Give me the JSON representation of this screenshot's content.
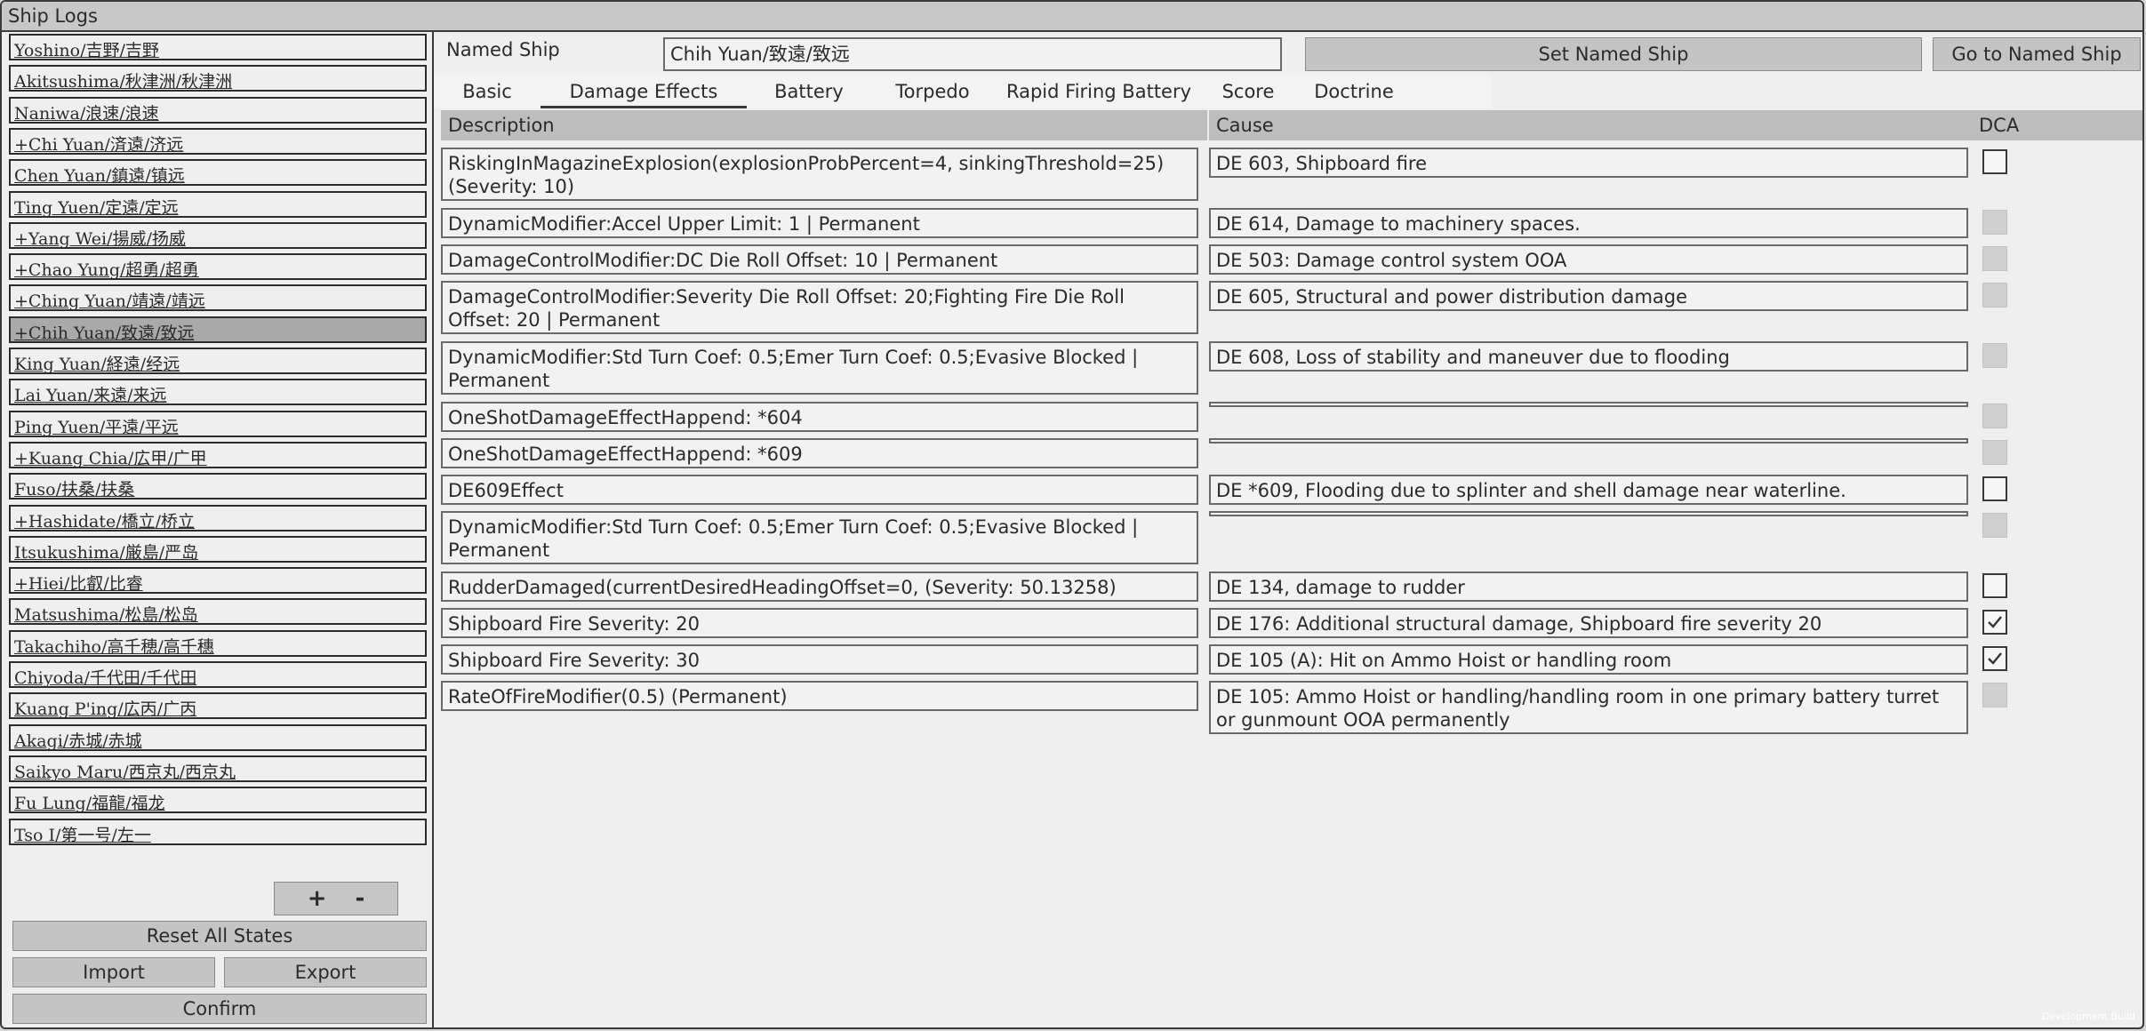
{
  "window": {
    "title": "Ship Logs"
  },
  "ships": [
    {
      "label": "Yoshino/吉野/吉野",
      "selected": false
    },
    {
      "label": "Akitsushima/秋津洲/秋津洲",
      "selected": false
    },
    {
      "label": "Naniwa/浪速/浪速",
      "selected": false
    },
    {
      "label": "+Chi Yuan/済遠/济远",
      "selected": false
    },
    {
      "label": "Chen Yuan/鎮遠/镇远",
      "selected": false
    },
    {
      "label": "Ting Yuen/定遠/定远",
      "selected": false
    },
    {
      "label": "+Yang Wei/揚威/扬威",
      "selected": false
    },
    {
      "label": "+Chao Yung/超勇/超勇",
      "selected": false
    },
    {
      "label": "+Ching Yuan/靖遠/靖远",
      "selected": false
    },
    {
      "label": "+Chih Yuan/致遠/致远",
      "selected": true
    },
    {
      "label": "King Yuan/経遠/经远",
      "selected": false
    },
    {
      "label": "Lai Yuan/来遠/来远",
      "selected": false
    },
    {
      "label": "Ping Yuen/平遠/平远",
      "selected": false
    },
    {
      "label": "+Kuang Chia/広甲/广甲",
      "selected": false
    },
    {
      "label": "Fuso/扶桑/扶桑",
      "selected": false
    },
    {
      "label": "+Hashidate/橋立/桥立",
      "selected": false
    },
    {
      "label": "Itsukushima/厳島/严岛",
      "selected": false
    },
    {
      "label": "+Hiei/比叡/比睿",
      "selected": false
    },
    {
      "label": "Matsushima/松島/松岛",
      "selected": false
    },
    {
      "label": "Takachiho/高千穂/高千穗",
      "selected": false
    },
    {
      "label": "Chiyoda/千代田/千代田",
      "selected": false
    },
    {
      "label": "Kuang P'ing/広丙/广丙",
      "selected": false
    },
    {
      "label": "Akagi/赤城/赤城",
      "selected": false
    },
    {
      "label": "Saikyo Maru/西京丸/西京丸",
      "selected": false
    },
    {
      "label": "Fu Lung/福龍/福龙",
      "selected": false
    },
    {
      "label": "Tso I/第一号/左一",
      "selected": false
    }
  ],
  "list_controls": {
    "add": "+",
    "remove": "-"
  },
  "actions": {
    "reset": "Reset All States",
    "import": "Import",
    "export": "Export",
    "confirm": "Confirm"
  },
  "named_ship": {
    "label": "Named Ship",
    "value": "Chih Yuan/致遠/致远",
    "set_button": "Set Named Ship",
    "goto_button": "Go to Named Ship"
  },
  "tabs": [
    {
      "label": "Basic",
      "active": false
    },
    {
      "label": "Damage Effects",
      "active": true
    },
    {
      "label": "Battery",
      "active": false
    },
    {
      "label": "Torpedo",
      "active": false
    },
    {
      "label": "Rapid Firing Battery",
      "active": false
    },
    {
      "label": "Score",
      "active": false
    },
    {
      "label": "Doctrine",
      "active": false
    }
  ],
  "table": {
    "columns": [
      "Description",
      "Cause",
      "DCA"
    ],
    "rows": [
      {
        "description": "RiskingInMagazineExplosion(explosionProbPercent=4, sinkingThreshold=25) (Severity: 10)",
        "cause": "DE 603, Shipboard fire",
        "dca": "empty"
      },
      {
        "description": "DynamicModifier:Accel Upper Limit: 1 | Permanent",
        "cause": "DE 614, Damage to machinery spaces.",
        "dca": "disabled"
      },
      {
        "description": "DamageControlModifier:DC Die Roll Offset: 10 | Permanent",
        "cause": "DE 503: Damage control system OOA",
        "dca": "disabled"
      },
      {
        "description": "DamageControlModifier:Severity Die Roll Offset: 20;Fighting Fire Die Roll Offset: 20 | Permanent",
        "cause": "DE 605, Structural and power distribution damage",
        "dca": "disabled"
      },
      {
        "description": "DynamicModifier:Std Turn Coef: 0.5;Emer Turn Coef: 0.5;Evasive Blocked | Permanent",
        "cause": "DE 608, Loss of stability and maneuver due to flooding",
        "dca": "disabled"
      },
      {
        "description": "OneShotDamageEffectHappend: *604",
        "cause": "",
        "dca": "disabled"
      },
      {
        "description": "OneShotDamageEffectHappend: *609",
        "cause": "",
        "dca": "disabled"
      },
      {
        "description": "DE609Effect",
        "cause": "DE *609, Flooding due to splinter and shell damage near waterline.",
        "dca": "empty"
      },
      {
        "description": "DynamicModifier:Std Turn Coef: 0.5;Emer Turn Coef: 0.5;Evasive Blocked | Permanent",
        "cause": "",
        "dca": "disabled"
      },
      {
        "description": "RudderDamaged(currentDesiredHeadingOffset=0, (Severity: 50.13258)",
        "cause": "DE 134, damage to rudder",
        "dca": "empty"
      },
      {
        "description": "Shipboard Fire Severity: 20",
        "cause": "DE 176: Additional structural damage, Shipboard fire severity 20",
        "dca": "checked"
      },
      {
        "description": "Shipboard Fire Severity: 30",
        "cause": "DE 105 (A): Hit on Ammo Hoist or handling room",
        "dca": "checked"
      },
      {
        "description": "RateOfFireModifier(0.5) (Permanent)",
        "cause": "DE 105: Ammo Hoist or handling/handling room in one primary battery turret or gunmount OOA permanently",
        "dca": "disabled"
      }
    ]
  },
  "watermark": "Development Build",
  "colors": {
    "selected_row": "#a9a9a9",
    "header": "#bdbdbd",
    "button": "#c4c4c4"
  }
}
